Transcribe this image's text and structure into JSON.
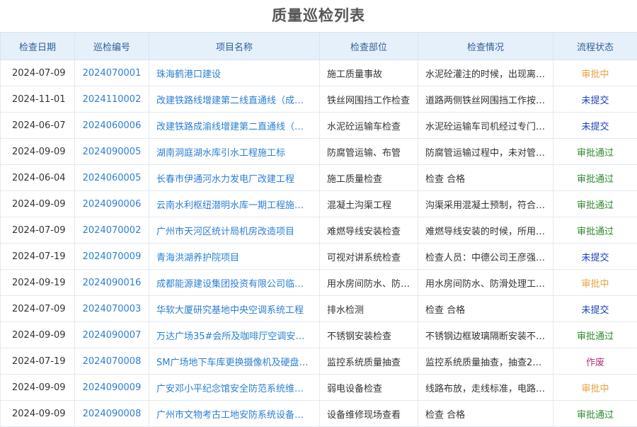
{
  "title": "质量巡检列表",
  "columns": [
    "检查日期",
    "巡检编号",
    "项目名称",
    "检查部位",
    "检查情况",
    "流程状态"
  ],
  "rows": [
    {
      "date": "2024-07-09",
      "no": "2024070001",
      "name": "珠海鹤港口建设",
      "part": "施工质量事故",
      "desc": "水泥砼灌注的时候，出现离…",
      "status": "审批中",
      "status_type": "pending"
    },
    {
      "date": "2024-11-01",
      "no": "2024110002",
      "name": "改建铁路线增建第二线直通线（成…",
      "part": "铁丝网围挡工作检查",
      "desc": "道路两侧铁丝网围挡工作按…",
      "status": "未提交",
      "status_type": "unsubmitted"
    },
    {
      "date": "2024-06-07",
      "no": "2024060006",
      "name": "改建铁路成渝线增建第二直通线（…",
      "part": "水泥砼运输车检查",
      "desc": "水泥砼运输车司机经过专门…",
      "status": "未提交",
      "status_type": "unsubmitted"
    },
    {
      "date": "2024-09-09",
      "no": "2024090005",
      "name": "湖南洞庭湖水库引水工程施工标",
      "part": "防腐管运输、布管",
      "desc": "防腐管运输过程中，未对管…",
      "status": "审批通过",
      "status_type": "approved"
    },
    {
      "date": "2024-06-04",
      "no": "2024060005",
      "name": "长春市伊通河水力发电厂改建工程",
      "part": "施工质量检查",
      "desc": "检查 合格",
      "status": "审批通过",
      "status_type": "approved"
    },
    {
      "date": "2024-09-09",
      "no": "2024090006",
      "name": "云南水利枢纽潜明水库一期工程施…",
      "part": "混凝土沟渠工程",
      "desc": "沟渠采用混凝土预制，符合…",
      "status": "审批通过",
      "status_type": "approved"
    },
    {
      "date": "2024-07-09",
      "no": "2024070002",
      "name": "广州市天河区统计局机房改造项目",
      "part": "难燃导线安装检查",
      "desc": "难燃导线安装的时候，所用…",
      "status": "审批通过",
      "status_type": "approved"
    },
    {
      "date": "2024-07-19",
      "no": "2024070009",
      "name": "青海洪湖养护院项目",
      "part": "可视对讲系统检查",
      "desc": "检查人员：中德公司王彦强…",
      "status": "未提交",
      "status_type": "unsubmitted"
    },
    {
      "date": "2024-09-19",
      "no": "2024090016",
      "name": "成都能源建设集团投资有限公司临…",
      "part": "用水房间防水、防…",
      "desc": "用水房间防水、防滑处理工…",
      "status": "审批中",
      "status_type": "pending"
    },
    {
      "date": "2024-07-09",
      "no": "2024070003",
      "name": "华软大厦研究基地中央空调系统工程",
      "part": "排水检测",
      "desc": "检查 合格",
      "status": "未提交",
      "status_type": "unsubmitted"
    },
    {
      "date": "2024-09-09",
      "no": "2024090007",
      "name": "万达广场35#会所及咖啡厅空调安装…",
      "part": "不锈钢安装检查",
      "desc": "不锈钢边框玻璃隔断安装不…",
      "status": "审批通过",
      "status_type": "approved"
    },
    {
      "date": "2024-07-19",
      "no": "2024070008",
      "name": "SM广场地下车库更换摄像机及硬盘…",
      "part": "监控系统质量抽查",
      "desc": "监控系统质量抽查，抽查28…",
      "status": "作废",
      "status_type": "void"
    },
    {
      "date": "2024-09-09",
      "no": "2024090009",
      "name": "广安邓小平纪念馆安全防范系统维…",
      "part": "弱电设备检查",
      "desc": "线路布放，走线标准，电路…",
      "status": "审批中",
      "status_type": "pending"
    },
    {
      "date": "2024-09-09",
      "no": "2024090008",
      "name": "广州市文物考古工地安防系统设备…",
      "part": "设备维修现场查看",
      "desc": "检查 合格",
      "status": "审批通过",
      "status_type": "approved"
    }
  ]
}
